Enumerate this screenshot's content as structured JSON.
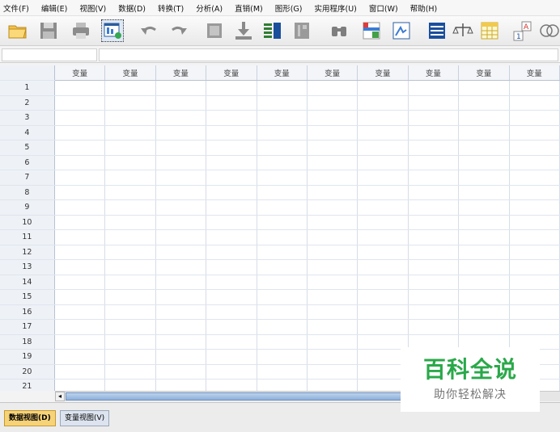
{
  "menu": {
    "items": [
      "文件(F)",
      "编辑(E)",
      "视图(V)",
      "数据(D)",
      "转换(T)",
      "分析(A)",
      "直销(M)",
      "图形(G)",
      "实用程序(U)",
      "窗口(W)",
      "帮助(H)"
    ]
  },
  "toolbar": {
    "buttons": [
      "open-icon",
      "save-icon",
      "print-icon",
      "recall-dialog-icon",
      "undo-icon",
      "redo-icon",
      "goto-case-icon",
      "goto-variable-icon",
      "variables-icon",
      "run-descriptive-icon",
      "find-icon",
      "insert-cases-icon",
      "insert-variable-icon",
      "split-file-icon",
      "weight-cases-icon",
      "select-cases-icon",
      "value-labels-icon",
      "use-sets-icon"
    ]
  },
  "grid": {
    "column_header": "变量",
    "columns": [
      "变量",
      "变量",
      "变量",
      "变量",
      "变量",
      "变量",
      "变量",
      "变量",
      "变量",
      "变量"
    ],
    "rows": [
      "1",
      "2",
      "3",
      "4",
      "5",
      "6",
      "7",
      "8",
      "9",
      "10",
      "11",
      "12",
      "13",
      "14",
      "15",
      "16",
      "17",
      "18",
      "19",
      "20",
      "21"
    ]
  },
  "scrollbar": {
    "left_arrow": "◂"
  },
  "tabs": {
    "data_view": "数据视图(D)",
    "variable_view": "变量视图(V)"
  },
  "watermark": {
    "title": "百科全说",
    "subtitle": "助你轻松解决"
  },
  "colors": {
    "active_tab": "#f6d279",
    "watermark_green": "#2aa84a",
    "scroll_thumb": "#8fb0d8"
  }
}
